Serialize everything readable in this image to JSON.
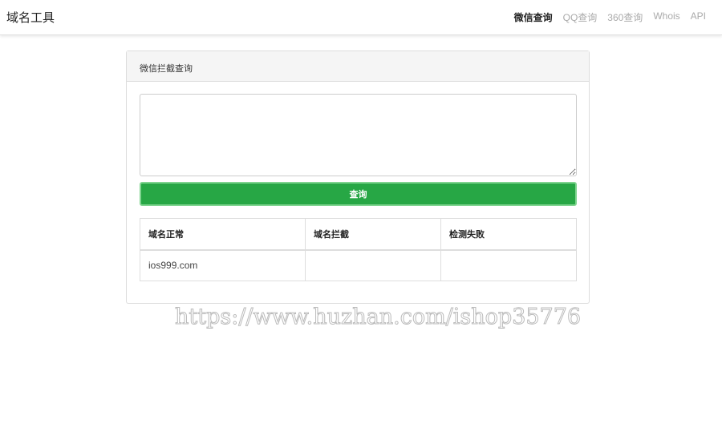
{
  "nav": {
    "brand": "域名工具",
    "links": [
      {
        "label": "微信查询",
        "active": true
      },
      {
        "label": "QQ查询"
      },
      {
        "label": "360查询"
      },
      {
        "label": "Whois"
      },
      {
        "label": "API"
      }
    ]
  },
  "panel": {
    "title": "微信拦截查询",
    "textarea_value": "",
    "button": "查询",
    "table": {
      "headers": [
        "域名正常",
        "域名拦截",
        "检测失败"
      ],
      "rows": [
        [
          "ios999.com",
          "",
          ""
        ]
      ]
    }
  },
  "watermark": "https://www.huzhan.com/ishop35776"
}
